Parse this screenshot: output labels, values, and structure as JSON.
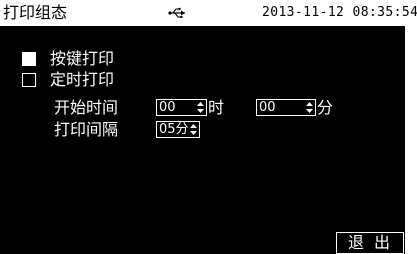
{
  "header": {
    "title": "打印组态",
    "usb_icon": "usb-icon",
    "datetime": "2013-11-12 08:35:54"
  },
  "options": {
    "key_print": {
      "label": "按键打印",
      "checked": true
    },
    "timed_print": {
      "label": "定时打印",
      "checked": false
    }
  },
  "start_time": {
    "label": "开始时间",
    "hour_value": "00",
    "hour_unit": "时",
    "minute_value": "00",
    "minute_unit": "分"
  },
  "interval": {
    "label": "打印间隔",
    "value": "05分"
  },
  "footer": {
    "exit_label": "退出"
  },
  "colors": {
    "screen_bg": "#000000",
    "header_bg": "#ffffff",
    "text": "#ffffff"
  }
}
